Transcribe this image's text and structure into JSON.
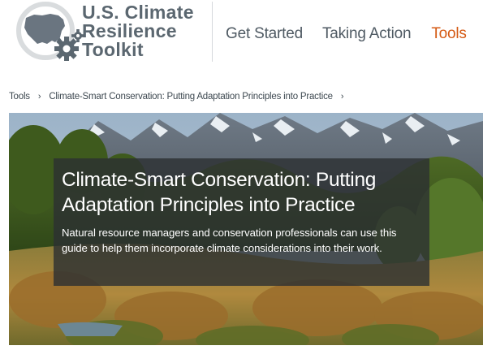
{
  "header": {
    "logo_lines": [
      "U.S. Climate",
      "Resilience",
      "Toolkit"
    ],
    "logo_icon": "us-map-gear-icon",
    "nav": [
      {
        "label": "Get Started",
        "active": false
      },
      {
        "label": "Taking Action",
        "active": false
      },
      {
        "label": "Tools",
        "active": true
      }
    ]
  },
  "breadcrumb": {
    "items": [
      "Tools",
      "Climate-Smart Conservation: Putting Adaptation Principles into Practice"
    ],
    "separator_icon": "chevron-right-icon"
  },
  "hero": {
    "title": "Climate-Smart Conservation: Putting Adaptation Principles into Practice",
    "description": "Natural resource managers and conservation professionals can use this guide to help them incorporate climate considerations into their work.",
    "image": "mountain-landscape-photo"
  },
  "colors": {
    "logo_gray": "#5b6770",
    "nav_text": "#4f5a63",
    "nav_active": "#d55a14",
    "overlay": "#2c2f32"
  }
}
